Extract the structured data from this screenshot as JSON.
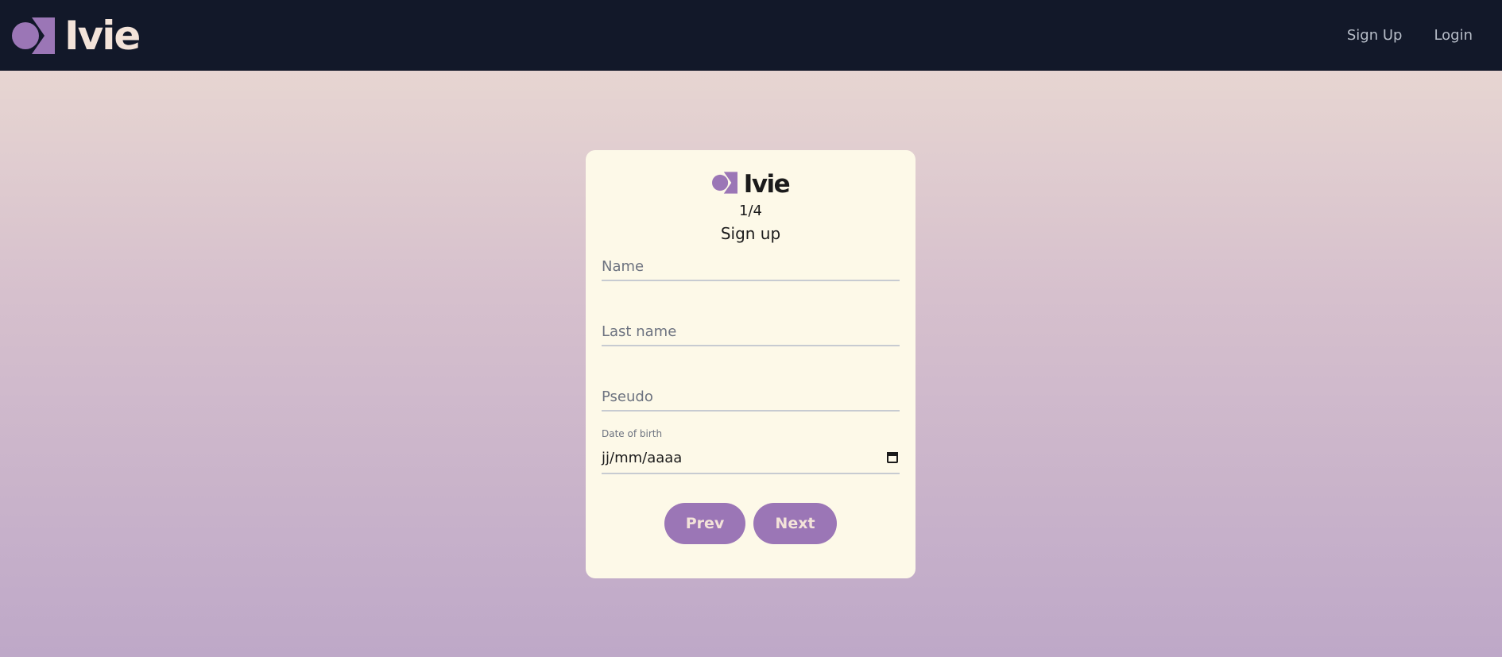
{
  "header": {
    "brand": "Ivie",
    "nav": [
      {
        "label": "Sign Up"
      },
      {
        "label": "Login"
      }
    ]
  },
  "form": {
    "brand": "Ivie",
    "step": "1/4",
    "title": "Sign up",
    "fields": {
      "name": {
        "placeholder": "Name",
        "value": ""
      },
      "last_name": {
        "placeholder": "Last name",
        "value": ""
      },
      "pseudo": {
        "placeholder": "Pseudo",
        "value": ""
      },
      "dob": {
        "label": "Date of birth",
        "value": "jj/mm/aaaa"
      }
    },
    "buttons": {
      "prev": "Prev",
      "next": "Next"
    }
  },
  "colors": {
    "topbar": "#121829",
    "accent": "#9b76b6",
    "brand_light": "#f3e3d9",
    "card": "#fdf9e8"
  },
  "icons": {
    "logo": "circle-triangle-logo-icon",
    "calendar": "calendar-icon"
  }
}
